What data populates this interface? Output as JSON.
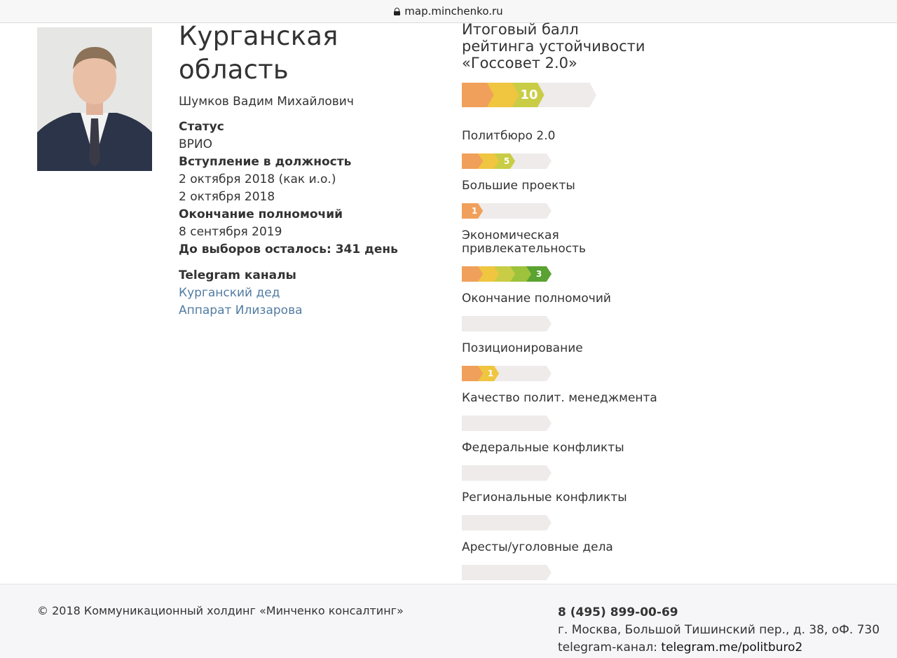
{
  "browser": {
    "url": "map.minchenko.ru"
  },
  "region": {
    "title": "Курганская область",
    "person": "Шумков Вадим Михайлович",
    "status_label": "Статус",
    "status_value": "ВРИО",
    "appointment_label": "Вступление в должность",
    "appointment_values": [
      "2 октября 2018 (как и.о.)",
      "2 октября 2018"
    ],
    "term_end_label": "Окончание полномочий",
    "term_end_value": "8 сентября 2019",
    "election_countdown": "До выборов осталось: 341 день",
    "telegram_label": "Telegram каналы",
    "telegram_links": [
      "Курганский дед",
      "Аппарат Илизарова"
    ]
  },
  "rating": {
    "title_lines": [
      "Итоговый балл",
      "рейтинга устойчивости",
      "«Госсовет 2.0»"
    ],
    "total": {
      "score": "10",
      "level": 3,
      "max": 5
    },
    "criteria": [
      {
        "label": "Политбюро 2.0",
        "score": "5",
        "level": 3
      },
      {
        "label": "Большие проекты",
        "score": "1",
        "level": 1
      },
      {
        "label": "Экономическая привлекательность",
        "label_lines": [
          "Экономическая",
          "привлекательность"
        ],
        "score": "3",
        "level": 5
      },
      {
        "label": "Окончание полномочий",
        "score": "",
        "level": 0
      },
      {
        "label": "Позиционирование",
        "score": "1",
        "level": 2
      },
      {
        "label": "Качество полит. менеджмента",
        "score": "",
        "level": 0
      },
      {
        "label": "Федеральные конфликты",
        "score": "",
        "level": 0
      },
      {
        "label": "Региональные конфликты",
        "score": "",
        "level": 0
      },
      {
        "label": "Аресты/уголовные дела",
        "score": "",
        "level": 0
      }
    ],
    "colors": [
      "#f0a05a",
      "#f0c540",
      "#c8cd45",
      "#9dc23c",
      "#5aa232"
    ],
    "empty_color": "#eeebea"
  },
  "footer": {
    "copyright": "© 2018 Коммуникационный холдинг «Минченко консалтинг»",
    "phone": "8 (495) 899-00-69",
    "address": "г. Москва, Большой Тишинский пер., д. 38, оФ. 730",
    "telegram_prefix": "telegram-канал: ",
    "telegram_link": "telegram.me/politburo2"
  }
}
